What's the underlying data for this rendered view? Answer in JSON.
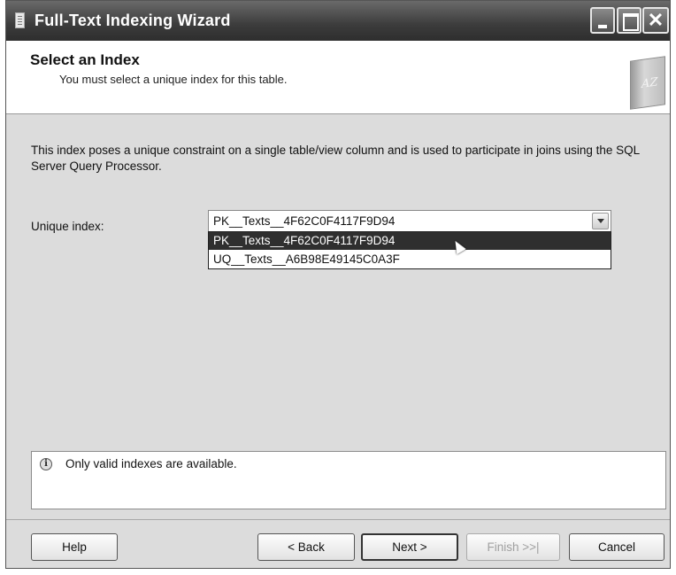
{
  "window": {
    "title": "Full-Text Indexing Wizard"
  },
  "header": {
    "title": "Select an Index",
    "subtitle": "You must select a unique index for this table.",
    "icon_text": "AZ"
  },
  "main": {
    "description": "This index poses a unique constraint on a single table/view column and is used to participate in joins using the SQL Server Query Processor.",
    "unique_index_label": "Unique index:",
    "unique_index_value": "PK__Texts__4F62C0F4117F9D94",
    "options": [
      "PK__Texts__4F62C0F4117F9D94",
      "UQ__Texts__A6B98E49145C0A3F"
    ]
  },
  "info": {
    "message": "Only valid indexes are available."
  },
  "buttons": {
    "help": "Help",
    "back": "< Back",
    "next": "Next >",
    "finish": "Finish >>|",
    "cancel": "Cancel"
  }
}
